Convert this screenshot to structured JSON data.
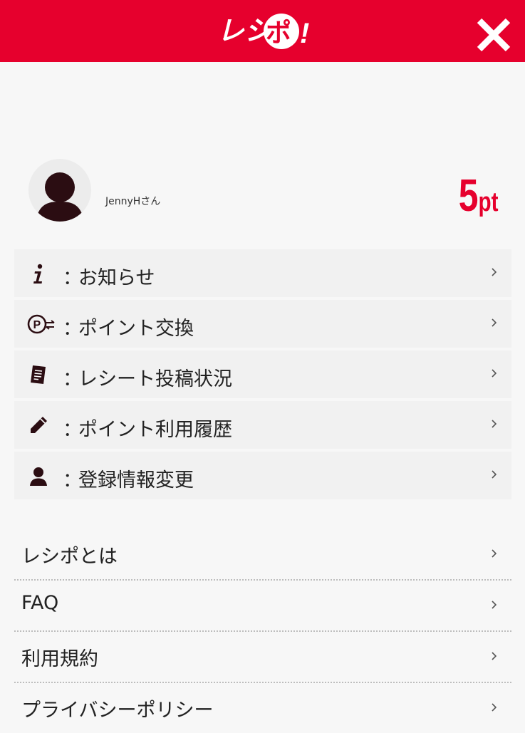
{
  "header": {
    "logo_text": "レシポ!",
    "brand_color": "#e6002d",
    "close_icon": "close-icon"
  },
  "profile": {
    "avatar_icon": "user-silhouette-icon",
    "username": "JennyHさん",
    "points_value": "5",
    "points_unit": "pt"
  },
  "menu": {
    "items": [
      {
        "icon": "info-icon",
        "colon": "：",
        "label": "お知らせ"
      },
      {
        "icon": "point-exchange-icon",
        "colon": "：",
        "label": "ポイント交換"
      },
      {
        "icon": "receipt-icon",
        "colon": "：",
        "label": "レシート投稿状況"
      },
      {
        "icon": "pencil-icon",
        "colon": "：",
        "label": "ポイント利用履歴"
      },
      {
        "icon": "user-icon",
        "colon": "：",
        "label": "登録情報変更"
      }
    ]
  },
  "links": {
    "items": [
      {
        "label": "レシポとは"
      },
      {
        "label": "FAQ"
      },
      {
        "label": "利用規約"
      },
      {
        "label": "プライバシーポリシー"
      }
    ]
  }
}
